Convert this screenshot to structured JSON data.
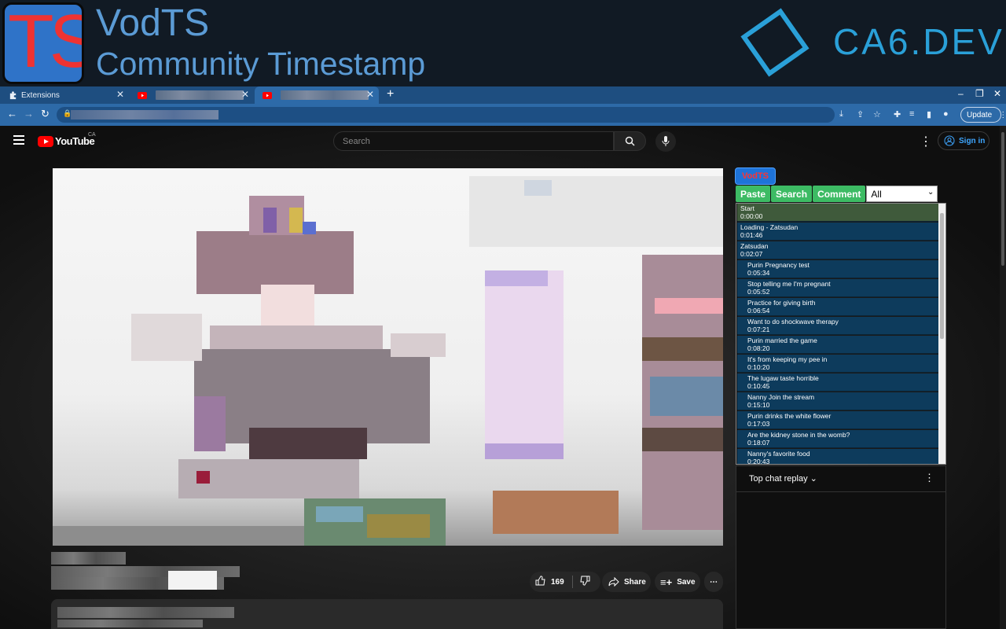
{
  "banner": {
    "logo_text": "TS",
    "title": "VodTS",
    "subtitle": "Community Timestamp",
    "brand": "CA6.DEV"
  },
  "browser": {
    "tabs": [
      {
        "label": "Extensions",
        "icon": "puzzle-icon"
      },
      {
        "label": "",
        "icon": "youtube-icon"
      },
      {
        "label": "",
        "icon": "youtube-icon"
      }
    ],
    "update_label": "Update"
  },
  "youtube": {
    "logo": "YouTube",
    "country": "CA",
    "search_placeholder": "Search",
    "signin": "Sign in",
    "likes": "169",
    "share": "Share",
    "save": "Save"
  },
  "vodts": {
    "tag": "VodTS",
    "buttons": [
      "Paste",
      "Search",
      "Comment"
    ],
    "filter": "All",
    "timestamps": [
      {
        "title": "Start",
        "time": "0:00:00",
        "level": 0,
        "active": true
      },
      {
        "title": "Loading - Zatsudan",
        "time": "0:01:46",
        "level": 0
      },
      {
        "title": "Zatsudan",
        "time": "0:02:07",
        "level": 0
      },
      {
        "title": "Purin Pregnancy test",
        "time": "0:05:34",
        "level": 1
      },
      {
        "title": "Stop telling me I'm pregnant",
        "time": "0:05:52",
        "level": 1
      },
      {
        "title": "Practice for giving birth",
        "time": "0:06:54",
        "level": 1
      },
      {
        "title": "Want to do shockwave therapy",
        "time": "0:07:21",
        "level": 1
      },
      {
        "title": "Purin married the game",
        "time": "0:08:20",
        "level": 1
      },
      {
        "title": "It's from keeping my pee in",
        "time": "0:10:20",
        "level": 1
      },
      {
        "title": "The lugaw taste horrible",
        "time": "0:10:45",
        "level": 1
      },
      {
        "title": "Nanny Join the stream",
        "time": "0:15:10",
        "level": 1
      },
      {
        "title": "Purin drinks the white flower",
        "time": "0:17:03",
        "level": 1
      },
      {
        "title": "Are the kidney stone in the womb?",
        "time": "0:18:07",
        "level": 1
      },
      {
        "title": "Nanny's favorite food",
        "time": "0:20:43",
        "level": 1
      }
    ]
  },
  "chat": {
    "header": "Top chat replay"
  }
}
